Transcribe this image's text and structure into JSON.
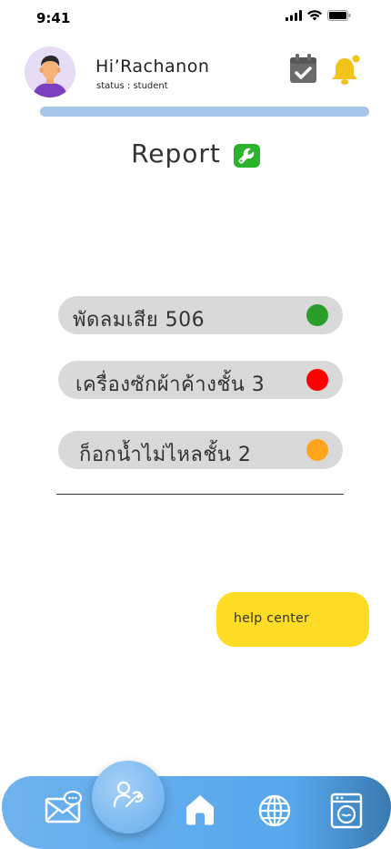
{
  "status_bar": {
    "time": "9:41"
  },
  "header": {
    "greeting": "Hi’Rachanon",
    "status": "status : student",
    "icons": {
      "calendar": "calendar-check-icon",
      "bell": "bell-icon"
    },
    "progress": 1.0
  },
  "main": {
    "title": "Report",
    "title_icon": "wrench-icon",
    "reports": [
      {
        "label": "พัดลมเสีย 506",
        "status_color": "#2a9e2a"
      },
      {
        "label": "เครื่องซักผ้าค้างชั้น 3",
        "status_color": "#ff0000"
      },
      {
        "label": "ก็อกน้ำไม่ไหลชั้น 2",
        "status_color": "#ffa41c"
      }
    ]
  },
  "help": {
    "label": "help center"
  },
  "nav": {
    "items": [
      "mail-chat-icon",
      "repair-person-icon",
      "home-icon",
      "globe-icon",
      "washing-machine-icon"
    ]
  },
  "colors": {
    "accent_yellow": "#fcdc25",
    "nav_blue": "#56a7ec",
    "progress_blue": "#a5c6e8",
    "report_bg": "#d9d9d9"
  }
}
